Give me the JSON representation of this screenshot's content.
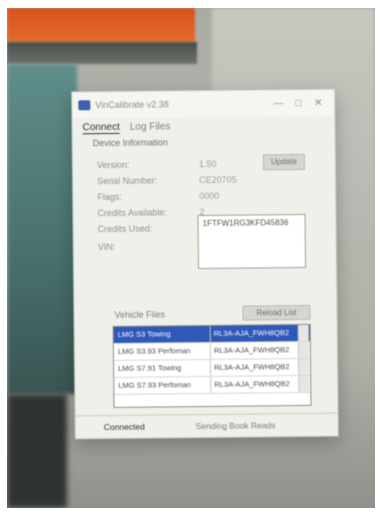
{
  "window": {
    "title": "VinCalibrate v2.38",
    "minimize_glyph": "—",
    "maximize_glyph": "□",
    "close_glyph": "✕"
  },
  "tabs": [
    {
      "label": "Connect",
      "active": true
    },
    {
      "label": "Log Files",
      "active": false
    }
  ],
  "device_info": {
    "group_label": "Device Information",
    "fields": [
      {
        "label": "Version:",
        "value": "1.50"
      },
      {
        "label": "Serial Number:",
        "value": "CE20705"
      },
      {
        "label": "Flags:",
        "value": "0000"
      },
      {
        "label": "Credits Available:",
        "value": "2"
      },
      {
        "label": "Credits Used:",
        "value": "1"
      },
      {
        "label": "VIN:",
        "value": "1FTFW1RG3KFD45836"
      }
    ],
    "update_button": "Update"
  },
  "vehicle_files": {
    "label": "Vehicle Files",
    "reload_button": "Reload List",
    "rows": [
      {
        "name": "LMG S3 Towing",
        "code": "RL3A-AJA_FWH8QB2",
        "selected": true
      },
      {
        "name": "LMG S3.93 Perfoman",
        "code": "RL3A-AJA_FWH8QB2",
        "selected": false
      },
      {
        "name": "LMG S7.91 Towing",
        "code": "RL3A-AJA_FWH8QB2",
        "selected": false
      },
      {
        "name": "LMG S7.93 Perfoman",
        "code": "RL3A-AJA_FWH8QB2",
        "selected": false
      }
    ]
  },
  "status": {
    "connection": "Connected",
    "message": "Sending Book Reads"
  },
  "colors": {
    "accent": "#2f58b8",
    "window_bg": "#eef0ea"
  }
}
